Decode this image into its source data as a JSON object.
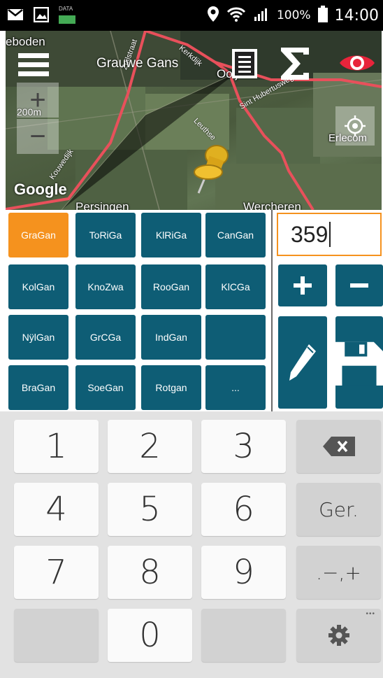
{
  "status_bar": {
    "data_label": "DATA",
    "battery": "100%",
    "time": "14:00"
  },
  "map": {
    "title": "Grauwe Gans",
    "place_labels": {
      "eboden": "eboden",
      "persingen": "Persingen",
      "wercheren": "Wercheren",
      "erlecom": "Erlecom",
      "ooij": "Ooij"
    },
    "street_labels": {
      "zuilstraat": "Zuilstraat",
      "kerkdijk": "Kerkdijk",
      "sint_hubertus": "Sint Hubertusweg",
      "leuthse": "Leuthse",
      "kouwedijk": "Kouwedijk"
    },
    "scale": "200m",
    "google": "Google",
    "zoom_in": "+",
    "zoom_out": "−"
  },
  "species": [
    {
      "label": "GraGan"
    },
    {
      "label": "ToRiGa"
    },
    {
      "label": "KlRiGa"
    },
    {
      "label": "CanGan"
    },
    {
      "label": "KolGan"
    },
    {
      "label": "KnoZwa"
    },
    {
      "label": "RooGan"
    },
    {
      "label": "KlCGa"
    },
    {
      "label": "NÿlGan"
    },
    {
      "label": "GrCGa"
    },
    {
      "label": "IndGan"
    },
    {
      "label": ""
    },
    {
      "label": "BraGan"
    },
    {
      "label": "SoeGan"
    },
    {
      "label": "Rotgan"
    },
    {
      "label": "..."
    }
  ],
  "count": {
    "value": "359"
  },
  "keyboard": {
    "k1": "1",
    "k2": "2",
    "k3": "3",
    "k4": "4",
    "k5": "5",
    "k6": "6",
    "k7": "7",
    "k8": "8",
    "k9": "9",
    "k0": "0",
    "ger": "Ger.",
    "symbols": ".−,+",
    "more": "•••"
  },
  "colors": {
    "accent": "#f5921e",
    "button": "#0e5d75",
    "route": "#e8505b"
  }
}
